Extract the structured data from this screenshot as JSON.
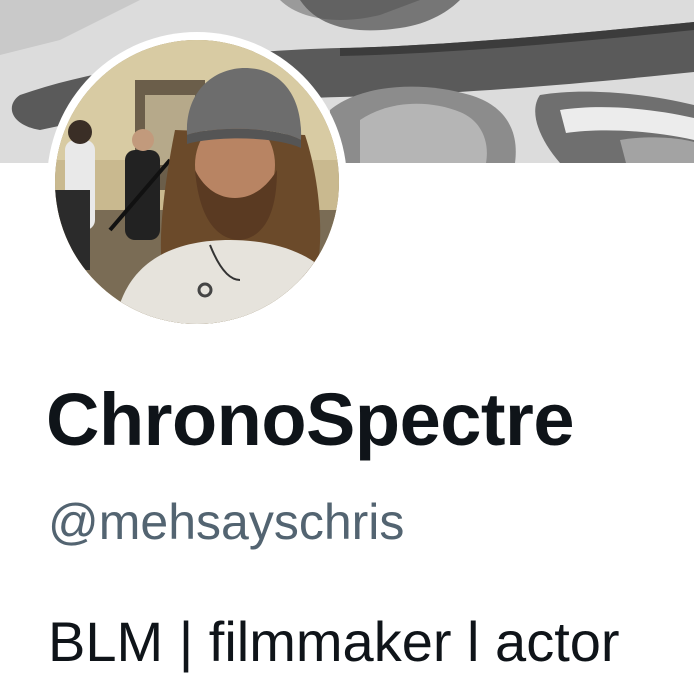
{
  "profile": {
    "display_name": "ChronoSpectre",
    "handle": "@mehsayschris",
    "bio": "BLM | filmmaker l actor"
  },
  "banner": {
    "description_icon": "banner-artwork-icon"
  },
  "avatar": {
    "icon": "profile-photo-icon"
  },
  "colors": {
    "name_text": "#0f1419",
    "handle_text": "#536471",
    "background": "#ffffff",
    "banner_base": "#d6d6d6"
  }
}
